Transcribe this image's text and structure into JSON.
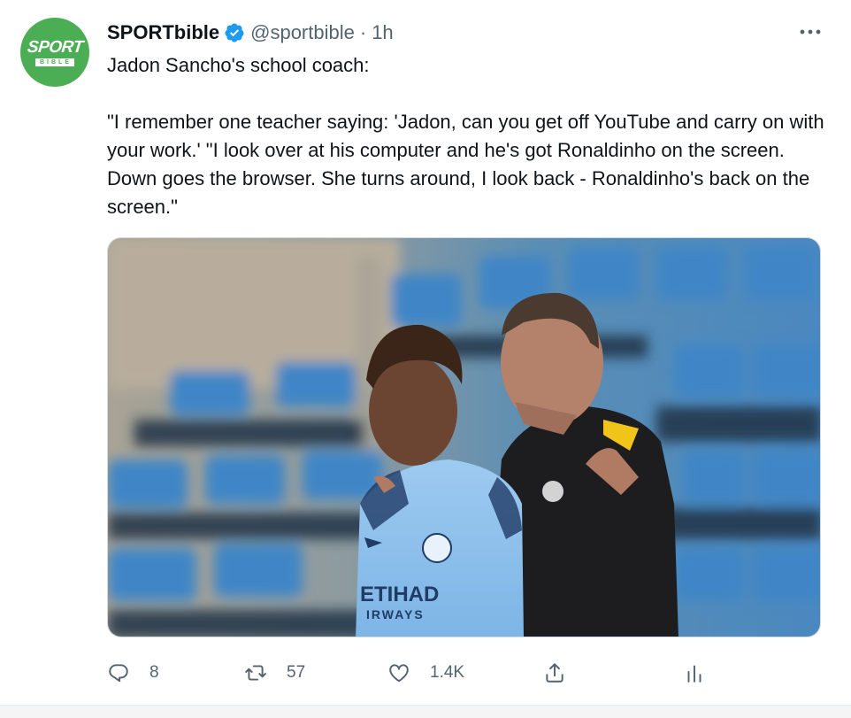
{
  "account": {
    "name": "SPORTbible",
    "handle": "@sportbible",
    "separator": "·",
    "time": "1h",
    "avatar_text": "SPORT",
    "avatar_subtext": "BIBLE",
    "verified_color": "#1d9bf0"
  },
  "tweet": {
    "line1": "Jadon Sancho's school coach:",
    "line2": "\"I remember one teacher saying: 'Jadon, can you get off YouTube and carry on with your work.' \"I look over at his computer and he's got Ronaldinho on the screen. Down goes the browser. She turns around, I look back - Ronaldinho's back on the screen.\""
  },
  "media": {
    "shirt_sponsor": "ETIHAD",
    "shirt_sponsor_sub": "IRWAYS"
  },
  "actions": {
    "reply_count": "8",
    "retweet_count": "57",
    "like_count": "1.4K"
  },
  "colors": {
    "brand_green": "#4cae54",
    "secondary_text": "#536471",
    "primary_text": "#0f1419"
  }
}
